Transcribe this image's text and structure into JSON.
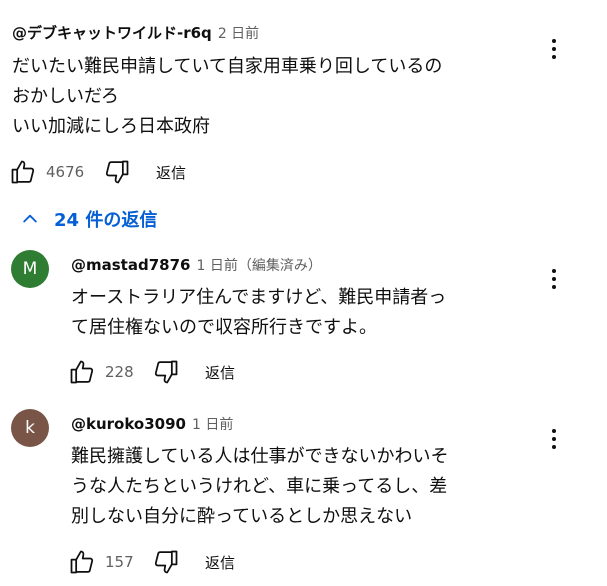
{
  "comment": {
    "author": "@デブキャットワイルド-r6q",
    "time": "2 日前",
    "lines": [
      "だいたい難民申請していて自家用車乗り回しているの",
      "おかしいだろ",
      "いい加減にしろ日本政府"
    ],
    "likes": "4676",
    "reply_label": "返信"
  },
  "replies_toggle": {
    "label": "24 件の返信",
    "icon": "chevron-up-icon"
  },
  "replies": [
    {
      "avatar_letter": "M",
      "avatar_color": "#2e7d32",
      "author": "@mastad7876",
      "time": "1 日前（編集済み）",
      "lines": [
        "オーストラリア住んでますけど、難民申請者っ",
        "て居住権ないので収容所行きですよ。"
      ],
      "likes": "228",
      "reply_label": "返信"
    },
    {
      "avatar_letter": "k",
      "avatar_color": "#795548",
      "author": "@kuroko3090",
      "time": "1 日前",
      "lines": [
        "難民擁護している人は仕事ができないかわいそ",
        "うな人たちというけれど、車に乗ってるし、差",
        "別しない自分に酔っているとしか思えない"
      ],
      "likes": "157",
      "reply_label": "返信"
    }
  ],
  "colors": {
    "link": "#065fd4",
    "meta": "#606060",
    "text": "#0f0f0f"
  }
}
